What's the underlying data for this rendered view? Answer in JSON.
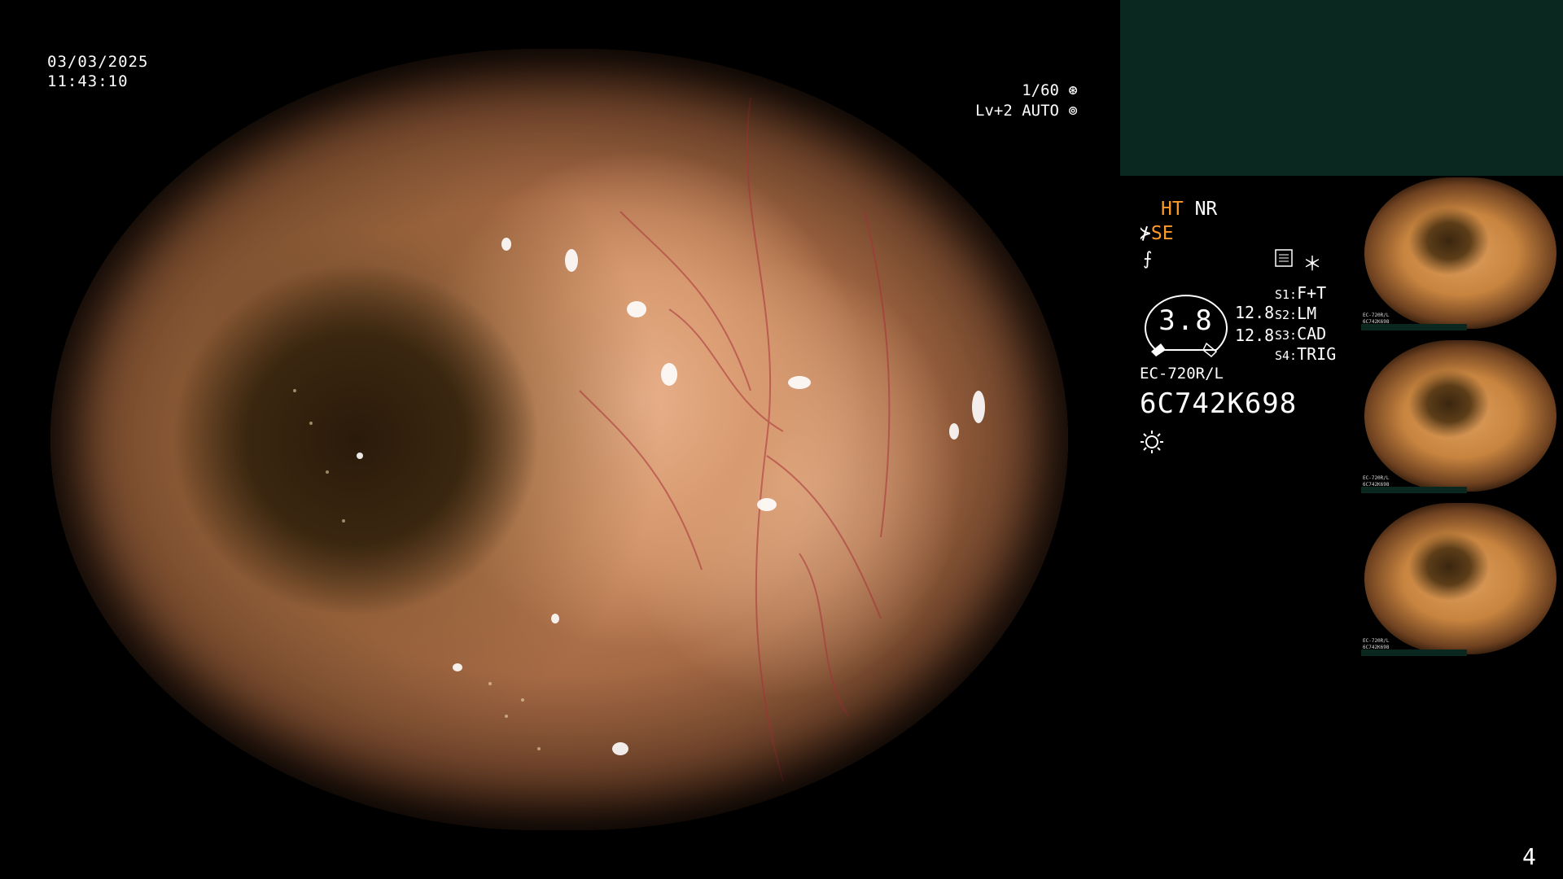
{
  "overlay": {
    "date": "03/03/2025",
    "time": "11:43:10",
    "shutter": "1/60",
    "level": "Lv+2 AUTO"
  },
  "panel": {
    "ht": "HT",
    "nr": "NR",
    "se": "SE",
    "gauge_value": "3.8",
    "levels": [
      "12.8",
      "12.8"
    ],
    "slots": [
      {
        "key": "S1:",
        "value": "F+T"
      },
      {
        "key": "S2:",
        "value": "LM"
      },
      {
        "key": "S3:",
        "value": "CAD"
      },
      {
        "key": "S4:",
        "value": "TRIG"
      }
    ],
    "model": "EC-720R/L",
    "serial": "6C742K698"
  },
  "thumbnails": {
    "model": "EC-720R/L",
    "serial": "6C742K698"
  },
  "page_number": "4",
  "colors": {
    "accent_orange": "#ff9a2a",
    "panel_green": "#0a2820"
  }
}
